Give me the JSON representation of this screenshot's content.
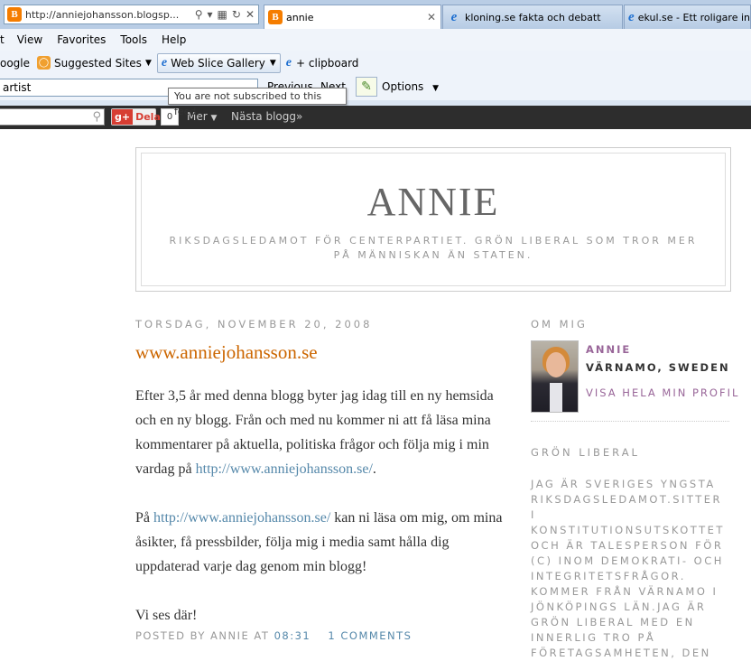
{
  "browser": {
    "address_url": "http://anniejohansson.blogsp...",
    "tabs": [
      {
        "label": "annie",
        "close": "✕"
      },
      {
        "label": "kloning.se fakta och debatt"
      },
      {
        "label": "ekul.se - Ett roligare in"
      }
    ],
    "menu": [
      "t",
      "View",
      "Favorites",
      "Tools",
      "Help"
    ],
    "favorites": {
      "google": "oogle",
      "suggested": "Suggested Sites",
      "webslice": "Web Slice Gallery",
      "clipboard": "+ clipboard"
    },
    "find_value": "artist",
    "previous": "Previous",
    "next": "Next",
    "options": "Options",
    "tooltip": "You are not subscribed to this feed."
  },
  "navbar": {
    "share": "Dela",
    "count": "0",
    "more": "Mer",
    "next_blog": "Nästa blogg»"
  },
  "blog": {
    "title": "ANNIE",
    "description": "Riksdagsledamot för Centerpartiet. Grön liberal som tror mer på människan än staten."
  },
  "post": {
    "date": "Torsdag, november 20, 2008",
    "title": "www.anniejohansson.se",
    "p1_pre": "Efter 3,5 år med denna blogg byter jag idag till en ny hemsida och en ny blogg. Från och med nu kommer ni att få läsa mina kommentarer på aktuella, politiska frågor och följa mig i min vardag på ",
    "p1_link": "http://www.anniejohansson.se/",
    "p1_post": ".",
    "p2_pre": "På ",
    "p2_link": "http://www.anniejohansson.se/",
    "p2_post": " kan ni läsa om mig, om mina åsikter, få pressbilder, följa mig i media samt hålla dig uppdaterad varje dag genom min blogg!",
    "p3": "Vi ses där!",
    "footer_posted": "Posted by Annie at ",
    "footer_time": "08:31",
    "footer_comments": "1 comments"
  },
  "sidebar": {
    "about_heading": "Om mig",
    "profile_name": "Annie",
    "profile_location": "Värnamo, Sweden",
    "profile_link": "Visa hela min profil",
    "section2_heading": "Grön liberal",
    "section2_text": "Jag är Sveriges yngsta riksdagsledamot.Sitter i konstitutionsutskottet och är talesperson för (c) inom demokrati- och integritetsfrågor. Kommer från Värnamo i Jönköpings län.Jag är grön liberal med en innerlig tro på företagsamheten, den"
  }
}
